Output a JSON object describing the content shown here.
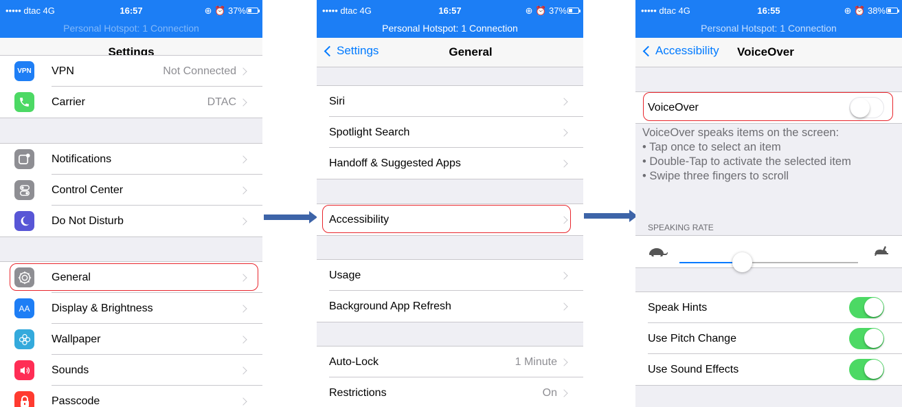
{
  "colors": {
    "status_bar": "#1c7ef5",
    "accent": "#007aff",
    "toggle_on": "#4cd964",
    "highlight": "#e8242b",
    "arrow": "#3d64a8"
  },
  "screens": [
    {
      "status": {
        "carrier": "••••• dtac  4G",
        "time": "16:57",
        "right": "⊕ ⏰ 37%",
        "battery_level": 0.37
      },
      "hotspot": "Personal Hotspot: 1 Connection",
      "title": "Settings",
      "rows": [
        {
          "label": "VPN",
          "value": "Not Connected",
          "icon": "vpn-icon",
          "icon_text": "VPN",
          "icon_color": "#1e7ef5"
        },
        {
          "label": "Carrier",
          "value": "DTAC",
          "icon": "phone-icon",
          "icon_color": "#4cd964"
        },
        {
          "label": "Notifications",
          "icon": "notifications-icon",
          "icon_color": "#8e8e93"
        },
        {
          "label": "Control Center",
          "icon": "control-center-icon",
          "icon_color": "#8e8e93"
        },
        {
          "label": "Do Not Disturb",
          "icon": "moon-icon",
          "icon_color": "#5856d6"
        },
        {
          "label": "General",
          "icon": "gear-icon",
          "icon_color": "#8e8e93"
        },
        {
          "label": "Display & Brightness",
          "icon": "display-icon",
          "icon_text": "AA",
          "icon_color": "#1e7ef5"
        },
        {
          "label": "Wallpaper",
          "icon": "wallpaper-icon",
          "icon_color": "#34aadc"
        },
        {
          "label": "Sounds",
          "icon": "speaker-icon",
          "icon_color": "#ff2d55"
        },
        {
          "label": "Passcode",
          "icon": "lock-icon",
          "icon_color": "#ff3b30"
        }
      ]
    },
    {
      "status": {
        "carrier": "••••• dtac  4G",
        "time": "16:57",
        "right": "⊕ ⏰ 37%",
        "battery_level": 0.37
      },
      "hotspot": "Personal Hotspot: 1 Connection",
      "back": "Settings",
      "title": "General",
      "rows": [
        {
          "label": "Siri"
        },
        {
          "label": "Spotlight Search"
        },
        {
          "label": "Handoff & Suggested Apps"
        },
        {
          "label": "Accessibility"
        },
        {
          "label": "Usage"
        },
        {
          "label": "Background App Refresh"
        },
        {
          "label": "Auto-Lock",
          "value": "1 Minute"
        },
        {
          "label": "Restrictions",
          "value": "On"
        }
      ]
    },
    {
      "status": {
        "carrier": "••••• dtac  4G",
        "time": "16:55",
        "right": "⊕ ⏰ 38%",
        "battery_level": 0.38
      },
      "hotspot": "Personal Hotspot: 1 Connection",
      "back": "Accessibility",
      "title": "VoiceOver",
      "voiceover": {
        "label": "VoiceOver",
        "on": false
      },
      "description": [
        "VoiceOver speaks items on the screen:",
        "• Tap once to select an item",
        "• Double-Tap to activate the selected item",
        "• Swipe three fingers to scroll"
      ],
      "speaking_rate": {
        "label": "SPEAKING RATE",
        "value": 0.35,
        "min_icon": "turtle-icon",
        "max_icon": "hare-icon"
      },
      "toggles": [
        {
          "label": "Speak Hints",
          "on": true
        },
        {
          "label": "Use Pitch Change",
          "on": true
        },
        {
          "label": "Use Sound Effects",
          "on": true
        }
      ]
    }
  ]
}
